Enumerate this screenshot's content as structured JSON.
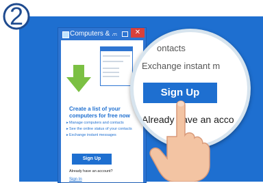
{
  "step": {
    "number": "2"
  },
  "window": {
    "title": "Computers & ...",
    "controls": {
      "minimize": "–",
      "close": "✕"
    }
  },
  "promo": {
    "title_line1": "Create a list of your",
    "title_line2": "computers for free now",
    "features": [
      "Manage computers and contacts",
      "See the online status of your contacts",
      "Exchange instant messages"
    ],
    "signup_label": "Sign Up",
    "have_account": "Already have an account?",
    "signin_label": "Sign In"
  },
  "magnifier": {
    "line_contacts": "ontacts",
    "line_exchange": "Exchange instant m",
    "signup_label": "Sign Up",
    "line_already": "Already have an acco"
  },
  "colors": {
    "accent": "#1e6fd0",
    "close": "#d9413b",
    "arrow": "#7bc043"
  }
}
